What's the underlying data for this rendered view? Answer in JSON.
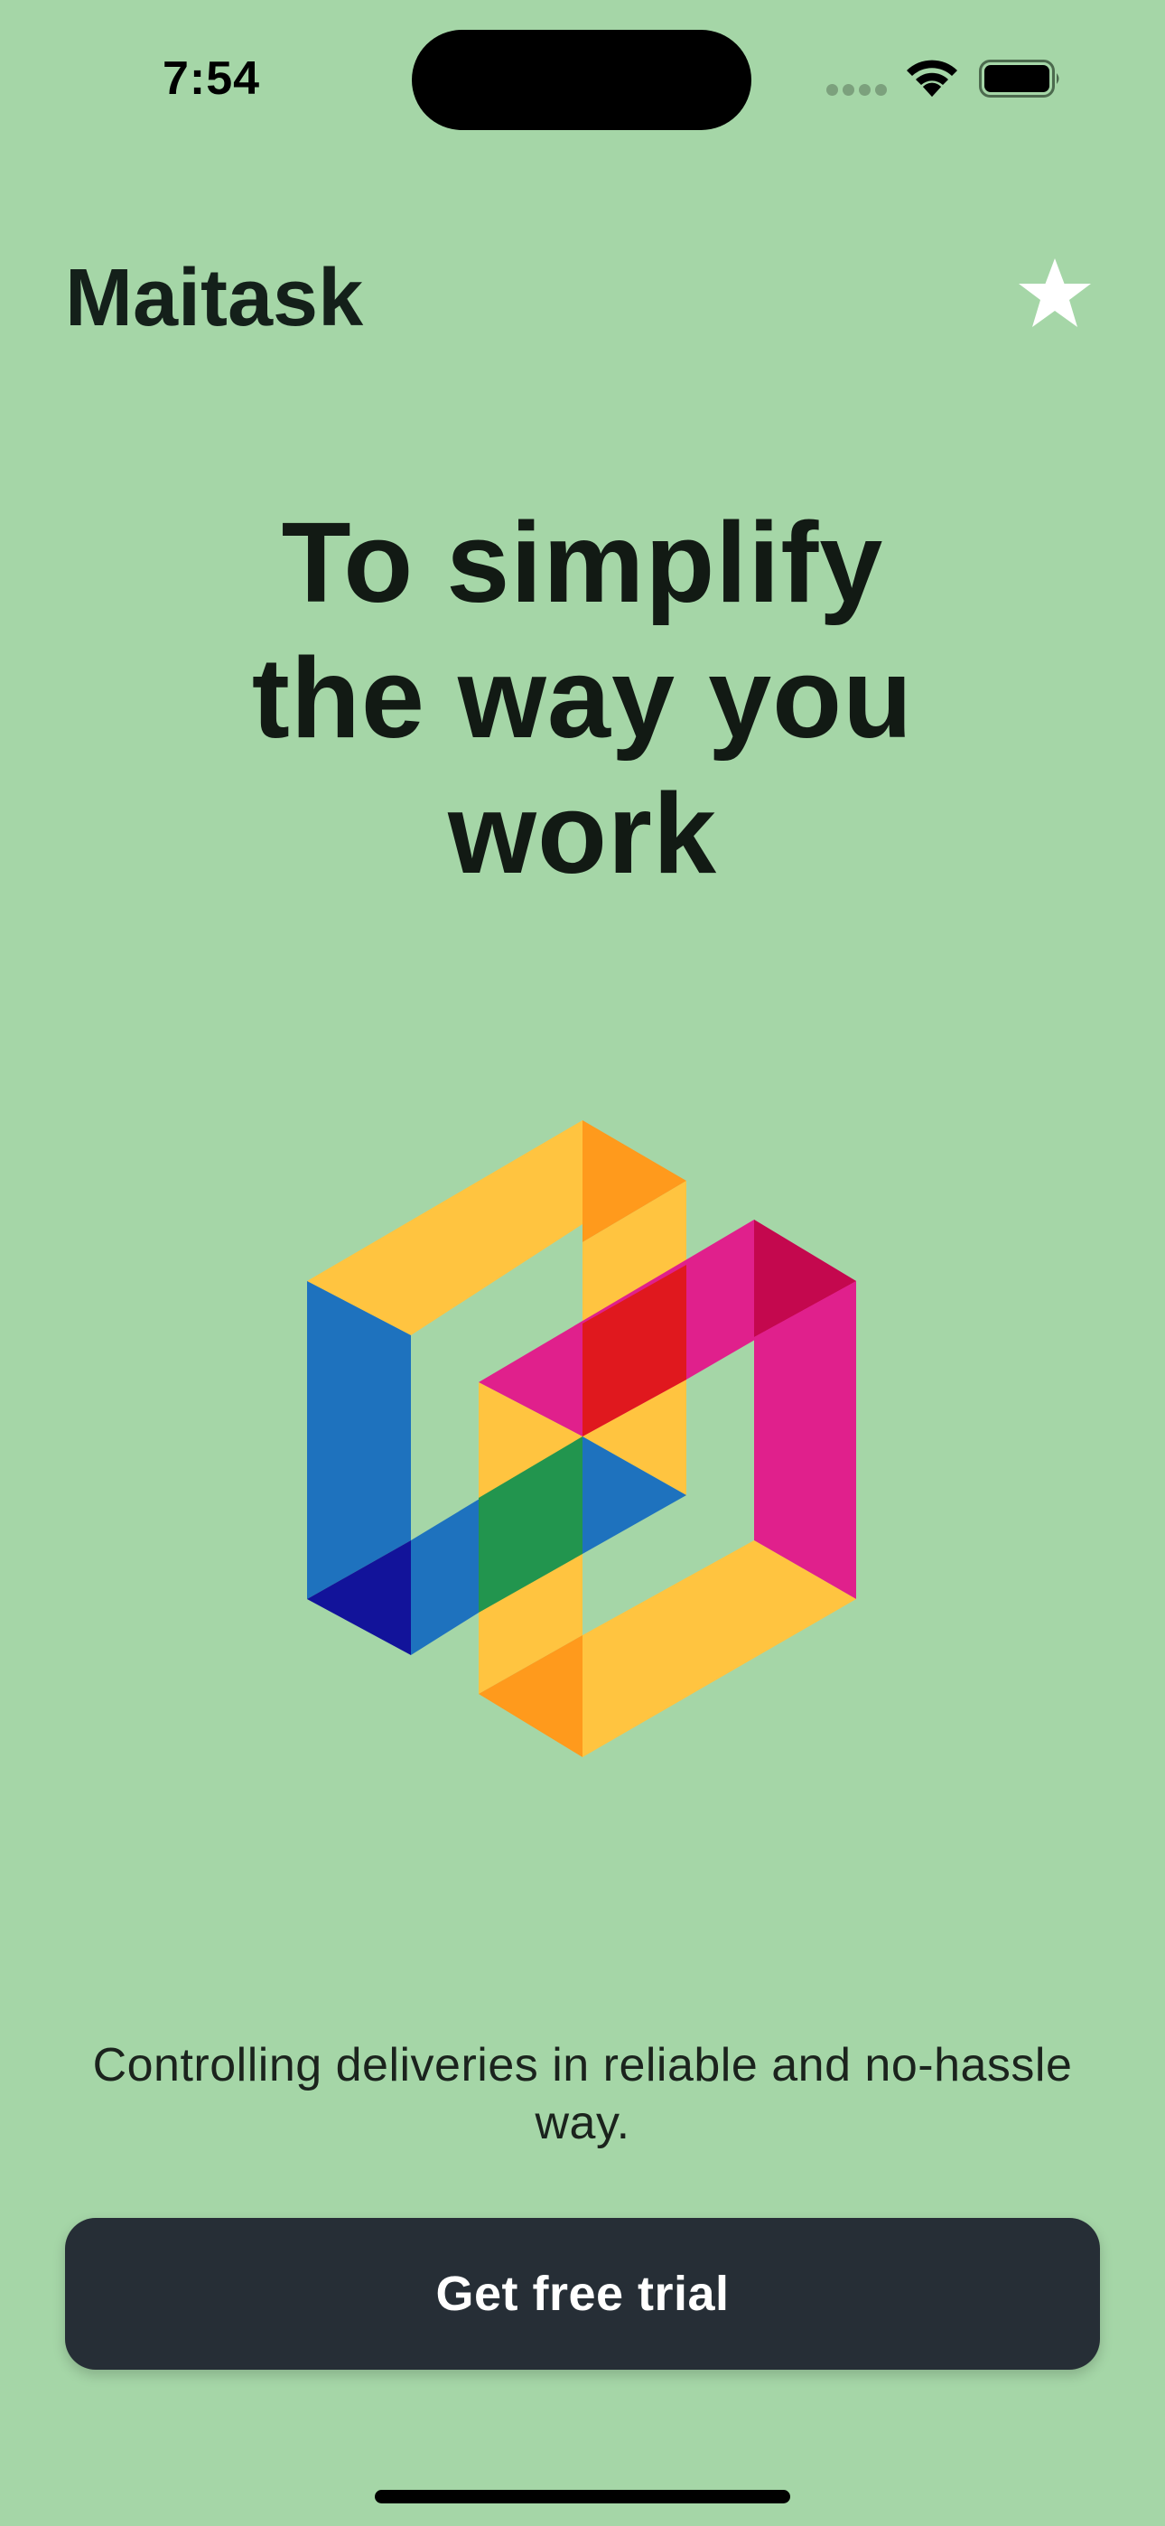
{
  "colors": {
    "background": "#a5d6a7",
    "text_primary": "#121a14",
    "button_background": "#262e36",
    "button_text": "#ffffff",
    "logo_yellow": "#ffc440",
    "logo_orange": "#ff9a1c",
    "logo_blue": "#1e72be",
    "logo_navy": "#12139a",
    "logo_magenta": "#e0208c",
    "logo_crimson": "#c4084e",
    "logo_red": "#e0181e",
    "logo_green": "#22954e"
  },
  "status_bar": {
    "time": "7:54",
    "icons": [
      "cellular-signal-icon",
      "wifi-icon",
      "battery-icon"
    ]
  },
  "header": {
    "title": "Maitask",
    "favorite_icon": "star-icon"
  },
  "hero": {
    "headline_lines": [
      "To simplify",
      "the way you",
      "work"
    ],
    "logo_icon": "maitask-logo-icon"
  },
  "tagline": "Controlling deliveries in reliable and no-hassle way.",
  "cta": {
    "label": "Get free trial"
  }
}
